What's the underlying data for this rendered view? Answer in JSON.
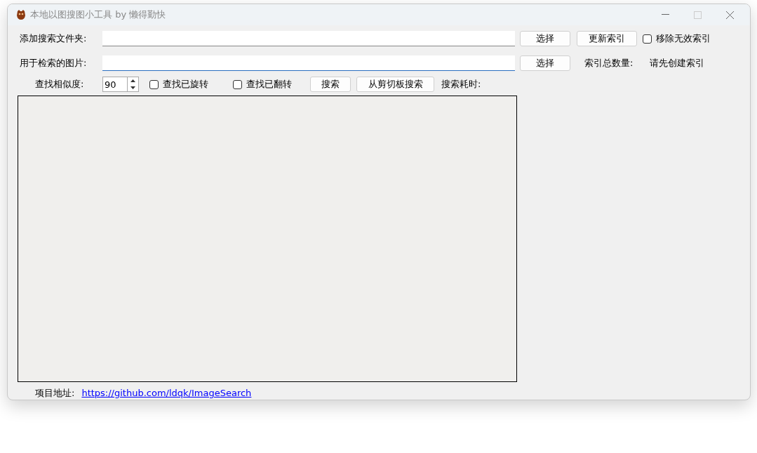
{
  "window": {
    "title": "本地以图搜图小工具 by 懒得勤快"
  },
  "folder_row": {
    "label": "添加搜索文件夹:",
    "button": "选择",
    "update_button": "更新索引",
    "remove_invalid": {
      "label": "移除无效索引",
      "checked": false
    }
  },
  "image_row": {
    "label": "用于检索的图片:",
    "button": "选择",
    "count_label": "索引总数量:",
    "count_value": "请先创建索引"
  },
  "search_row": {
    "similarity_label": "查找相似度:",
    "similarity": "90",
    "find_rotated": {
      "label": "查找已旋转",
      "checked": false
    },
    "find_flipped": {
      "label": "查找已翻转",
      "checked": false
    },
    "search_button": "搜索",
    "clipboard_button": "从剪切板搜索",
    "time_label": "搜索耗时:"
  },
  "footer": {
    "label": "项目地址:",
    "link": "https://github.com/ldqk/ImageSearch"
  }
}
